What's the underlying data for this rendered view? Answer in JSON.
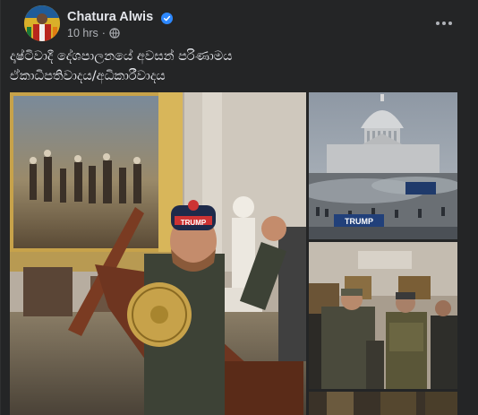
{
  "post": {
    "author": "Chatura Alwis",
    "time": "10 hrs",
    "separator": "·",
    "text_line1": "දෘෂ්ටිවාදී දේශපාලනයේ අවසන් පරිණාමය",
    "text_line2": "ඒකාධිපතිවාදය/අධිකාරීවාදය"
  },
  "photos": {
    "banner_text": "TRUMP",
    "beanie_text": "TRUMP"
  },
  "colors": {
    "card_bg": "#242526",
    "page_bg": "#18191a",
    "text_primary": "#e4e6eb",
    "text_secondary": "#b0b3b8",
    "verified_blue": "#2d88ff"
  },
  "icons": {
    "verified": "verified-badge-icon",
    "privacy": "globe-icon",
    "more": "more-horizontal-icon"
  }
}
